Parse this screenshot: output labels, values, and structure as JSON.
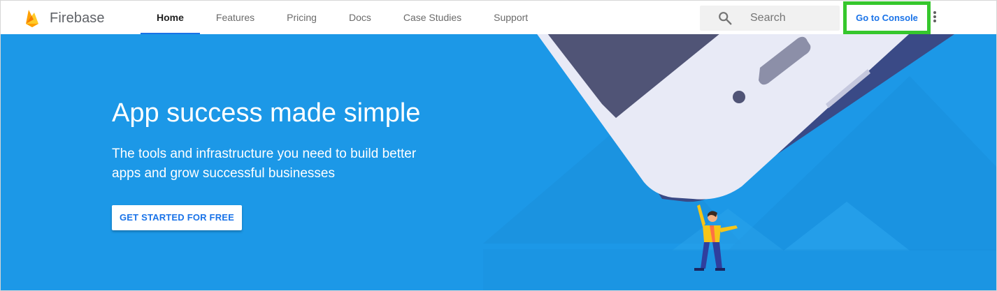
{
  "header": {
    "brand_name": "Firebase",
    "logo_icon": "firebase-flame-icon",
    "nav": [
      {
        "label": "Home",
        "active": true
      },
      {
        "label": "Features",
        "active": false
      },
      {
        "label": "Pricing",
        "active": false
      },
      {
        "label": "Docs",
        "active": false
      },
      {
        "label": "Case Studies",
        "active": false
      },
      {
        "label": "Support",
        "active": false
      }
    ],
    "search": {
      "placeholder": "Search",
      "icon": "search-icon"
    },
    "console_button": "Go to Console",
    "more_icon": "more-vert-icon"
  },
  "hero": {
    "headline": "App success made simple",
    "subline": "The tools and infrastructure you need to build better apps and grow successful businesses",
    "cta": "GET STARTED FOR FREE"
  },
  "colors": {
    "hero_background": "#1c98e7",
    "accent_blue": "#1a73e8",
    "highlight_green": "#36c72d",
    "flame_yellow": "#ffca28",
    "flame_orange": "#ffa000"
  }
}
